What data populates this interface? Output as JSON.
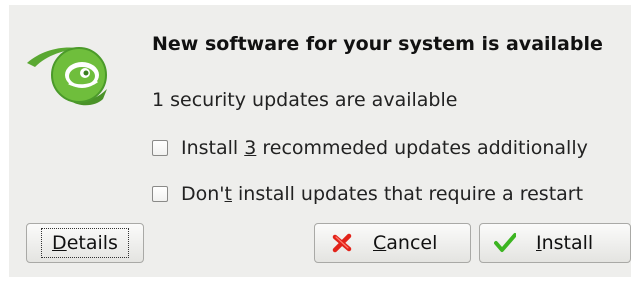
{
  "dialog": {
    "logo_icon": "opensuse-gecko-icon",
    "headline": "New software for your system is available",
    "security_text": "1 security updates are available",
    "options": [
      {
        "label_before": "Install ",
        "label_mnemonic": "3",
        "label_after": " recommeded updates additionally",
        "checked": false
      },
      {
        "label_before": "Don'",
        "label_mnemonic": "t",
        "label_after": " install updates that require a restart",
        "checked": false
      }
    ],
    "buttons": {
      "details": {
        "mnemonic": "D",
        "rest": "etails"
      },
      "cancel": {
        "mnemonic": "C",
        "rest": "ancel",
        "icon": "red-x-icon"
      },
      "install": {
        "mnemonic": "I",
        "rest": "nstall",
        "icon": "green-checkmark-icon"
      }
    },
    "colors": {
      "dialog_background": "#eeeeec",
      "logo_green": "#5aa832",
      "cancel_red": "#e2231a",
      "install_green": "#3cb521"
    }
  }
}
